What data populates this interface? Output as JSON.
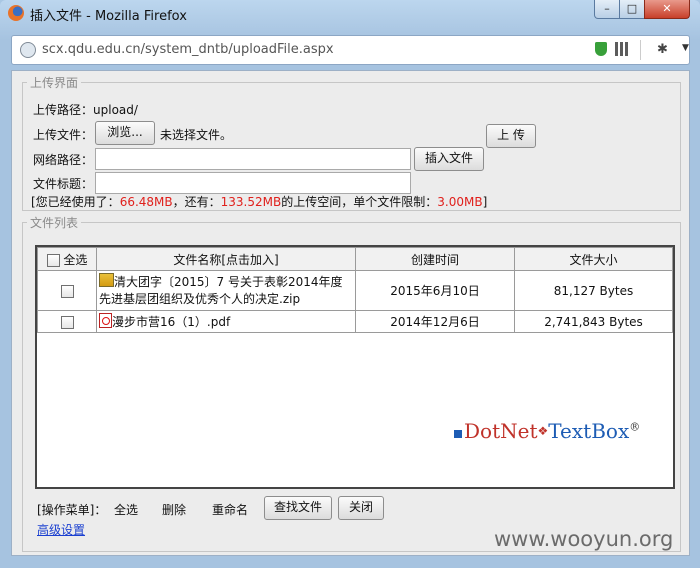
{
  "window": {
    "title": "插入文件 - Mozilla Firefox",
    "controls": {
      "minimize": "–",
      "maximize": "□",
      "close": "✕"
    }
  },
  "urlbar": {
    "url": "scx.qdu.edu.cn/system_dntb/uploadFile.aspx"
  },
  "upload": {
    "legend": "上传界面",
    "path_label": "上传路径：",
    "path_value": "upload/",
    "file_label": "上传文件：",
    "browse_button": "浏览...",
    "no_file_text": "未选择文件。",
    "upload_button": "上 传",
    "netpath_label": "网络路径：",
    "netpath_value": "",
    "insert_button": "插入文件",
    "title_label": "文件标题：",
    "title_value": "",
    "quota": {
      "prefix": "[您已经使用了：",
      "used": "66.48MB",
      "mid1": "，还有：",
      "remaining": "133.52MB",
      "mid2": "的上传空间，单个文件限制：",
      "limit": "3.00MB",
      "suffix": "]"
    }
  },
  "list": {
    "legend": "文件列表",
    "headers": {
      "select_all": "全选",
      "name": "文件名称[点击加入]",
      "created": "创建时间",
      "size": "文件大小"
    },
    "rows": [
      {
        "name": "清大团字〔2015〕7 号关于表彰2014年度先进基层团组织及优秀个人的决定.zip",
        "icon": "zip-file-icon",
        "created": "2015年6月10日",
        "size": "81,127 Bytes"
      },
      {
        "name": "漫步市营16（1）.pdf",
        "icon": "pdf-file-icon",
        "created": "2014年12月6日",
        "size": "2,741,843 Bytes"
      }
    ]
  },
  "actions": {
    "label": "[操作菜单]：",
    "select_all": "全选",
    "delete": "删除",
    "rename": "重命名",
    "find_file": "查找文件",
    "close": "关闭",
    "advanced": "高级设置"
  },
  "brand": {
    "part1": "DotNet",
    "sep": "❖",
    "part2": "TextBox",
    "reg": "®"
  },
  "watermark": "www.wooyun.org",
  "colors": {
    "accent_red": "#e0201c",
    "link_blue": "#1a3fd0",
    "brand_red": "#c0322a",
    "brand_blue": "#1d5cb4"
  }
}
